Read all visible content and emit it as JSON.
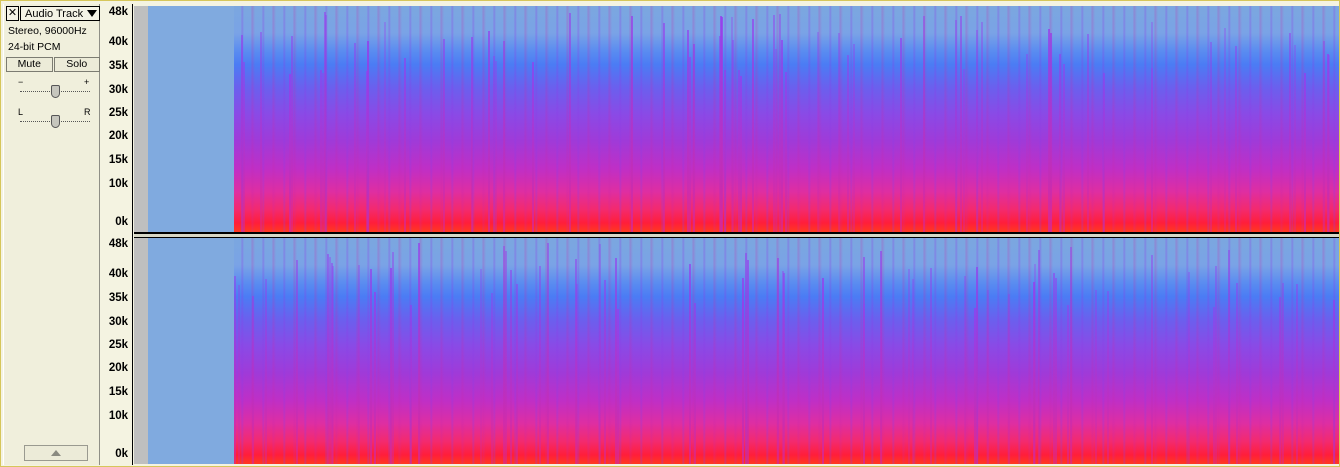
{
  "track": {
    "name": "Audio Track",
    "close_label": "✕",
    "format_line1": "Stereo, 96000Hz",
    "format_line2": "24-bit PCM",
    "mute_label": "Mute",
    "solo_label": "Solo",
    "gain_minus": "−",
    "gain_plus": "+",
    "pan_left": "L",
    "pan_right": "R",
    "gain_value": 0.5,
    "pan_value": 0.5
  },
  "ruler": {
    "ticks": [
      "48k",
      "40k",
      "35k",
      "30k",
      "25k",
      "20k",
      "15k",
      "10k",
      "0k"
    ]
  },
  "colors": {
    "background_blue": "#7ba7df",
    "high_energy": "#ff1e3a",
    "mid_energy": "#8a4ae6"
  },
  "icons": {
    "close": "close-icon",
    "dropdown": "chevron-down-icon",
    "collapse": "chevron-up-icon"
  }
}
